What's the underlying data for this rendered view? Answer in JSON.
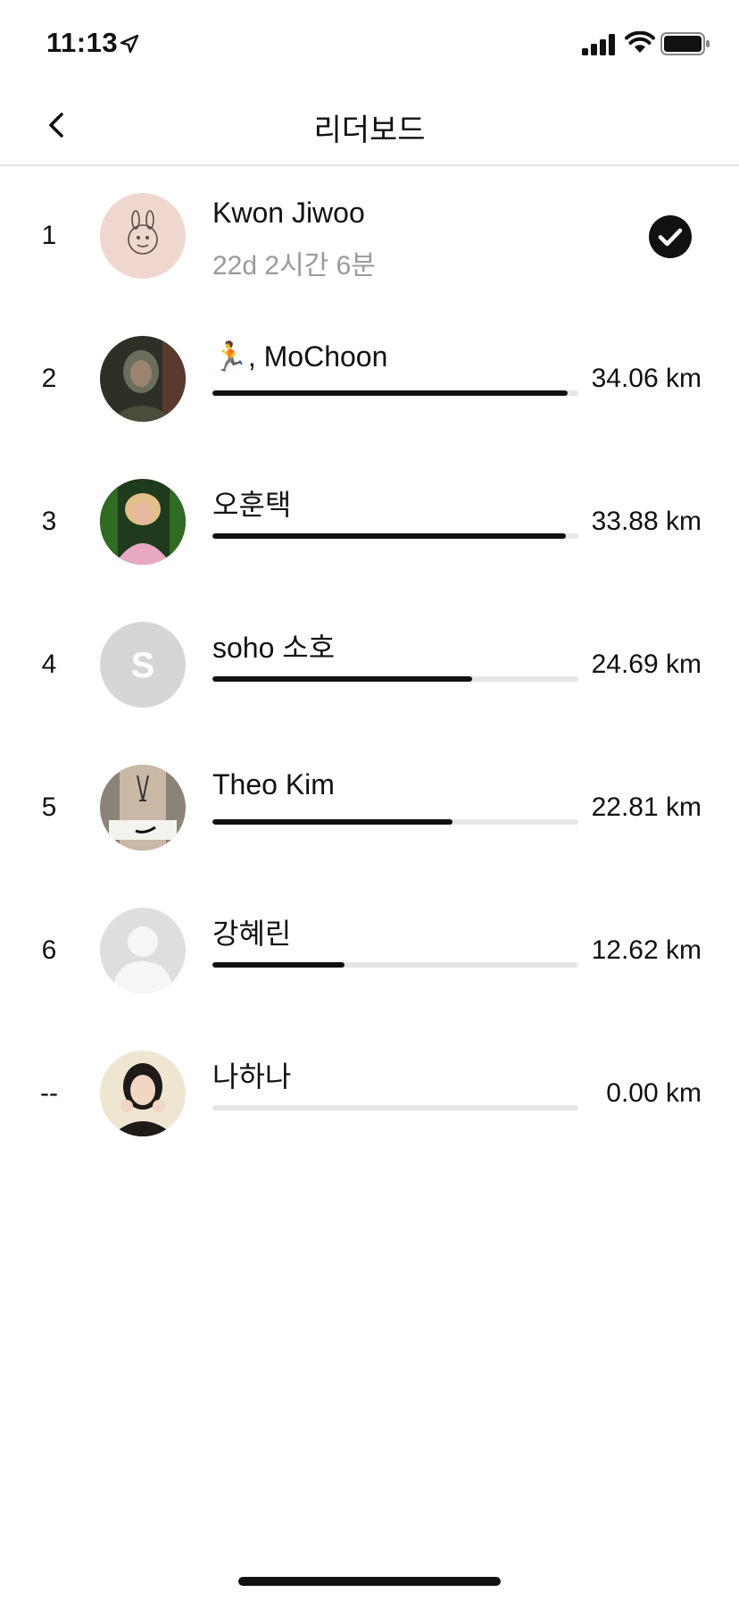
{
  "status_bar": {
    "time": "11:13"
  },
  "nav": {
    "title": "리더보드",
    "back_icon": "chevron-left-icon"
  },
  "leaderboard": [
    {
      "rank": "1",
      "name": "Kwon Jiwoo",
      "sub": "22d 2시간 6분",
      "completed": true,
      "avatar": "photo"
    },
    {
      "rank": "2",
      "name": "🏃, MoChoon",
      "distance": "34.06 km",
      "progress": 0.97,
      "avatar": "photo"
    },
    {
      "rank": "3",
      "name": "오훈택",
      "distance": "33.88 km",
      "progress": 0.965,
      "avatar": "photo"
    },
    {
      "rank": "4",
      "name": "soho 소호",
      "distance": "24.69 km",
      "progress": 0.71,
      "avatar": "initial",
      "initial": "S"
    },
    {
      "rank": "5",
      "name": "Theo Kim",
      "distance": "22.81 km",
      "progress": 0.655,
      "avatar": "photo"
    },
    {
      "rank": "6",
      "name": "강혜린",
      "distance": "12.62 km",
      "progress": 0.36,
      "avatar": "placeholder"
    },
    {
      "rank": "--",
      "name": "나하나",
      "distance": "0.00 km",
      "progress": 0.0,
      "avatar": "photo"
    }
  ]
}
